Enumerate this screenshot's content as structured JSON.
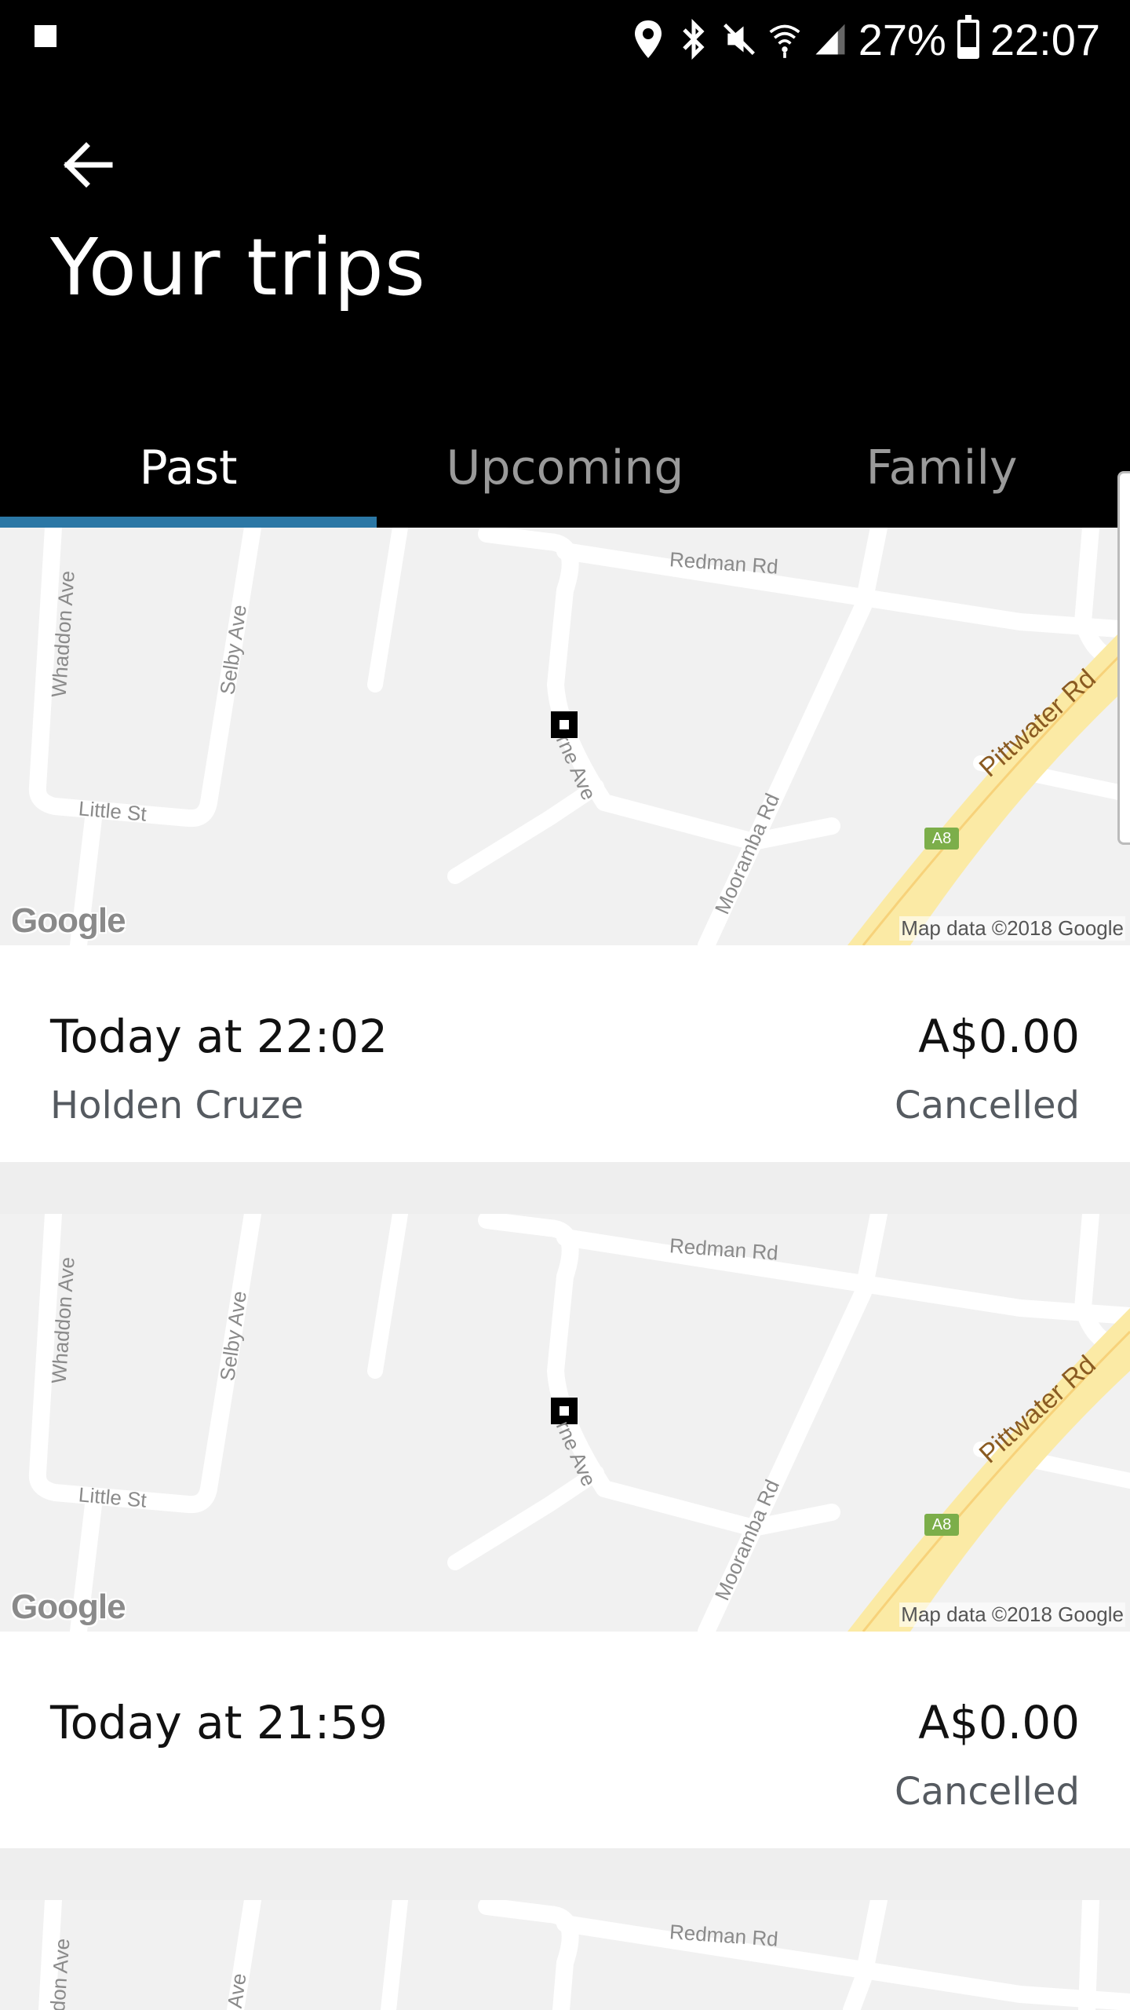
{
  "status_bar": {
    "battery_percent": "27%",
    "battery_level": 0.27,
    "time": "22:07",
    "icons": [
      "notification-square-icon",
      "location-icon",
      "bluetooth-icon",
      "mute-icon",
      "wifi-icon",
      "signal-icon",
      "battery-icon"
    ]
  },
  "header": {
    "back_icon": "arrow-left-icon",
    "title": "Your trips"
  },
  "tabs": [
    {
      "label": "Past",
      "active": true
    },
    {
      "label": "Upcoming",
      "active": false
    },
    {
      "label": "Family",
      "active": false
    }
  ],
  "map": {
    "streets": [
      "Redman Rd",
      "Whaddon Ave",
      "Selby Ave",
      "Little St",
      "Mooramba Rd",
      "Pittwater Rd"
    ],
    "partial_street": "rne Ave",
    "route_shield": "A8",
    "logo": "Google",
    "attribution": "Map data ©2018 Google"
  },
  "trips": [
    {
      "time": "Today at 22:02",
      "vehicle": "Holden Cruze",
      "fare": "A$0.00",
      "status": "Cancelled"
    },
    {
      "time": "Today at 21:59",
      "vehicle": "",
      "fare": "A$0.00",
      "status": "Cancelled"
    }
  ],
  "partial_trip_map": {
    "streets": [
      "Redman Rd",
      "don Ave",
      "Ave"
    ]
  },
  "colors": {
    "header_bg": "#000000",
    "tab_indicator": "#2b77a5",
    "secondary_text": "#555a60",
    "map_bg": "#f1f1f1",
    "major_road": "#fbeaa5"
  }
}
